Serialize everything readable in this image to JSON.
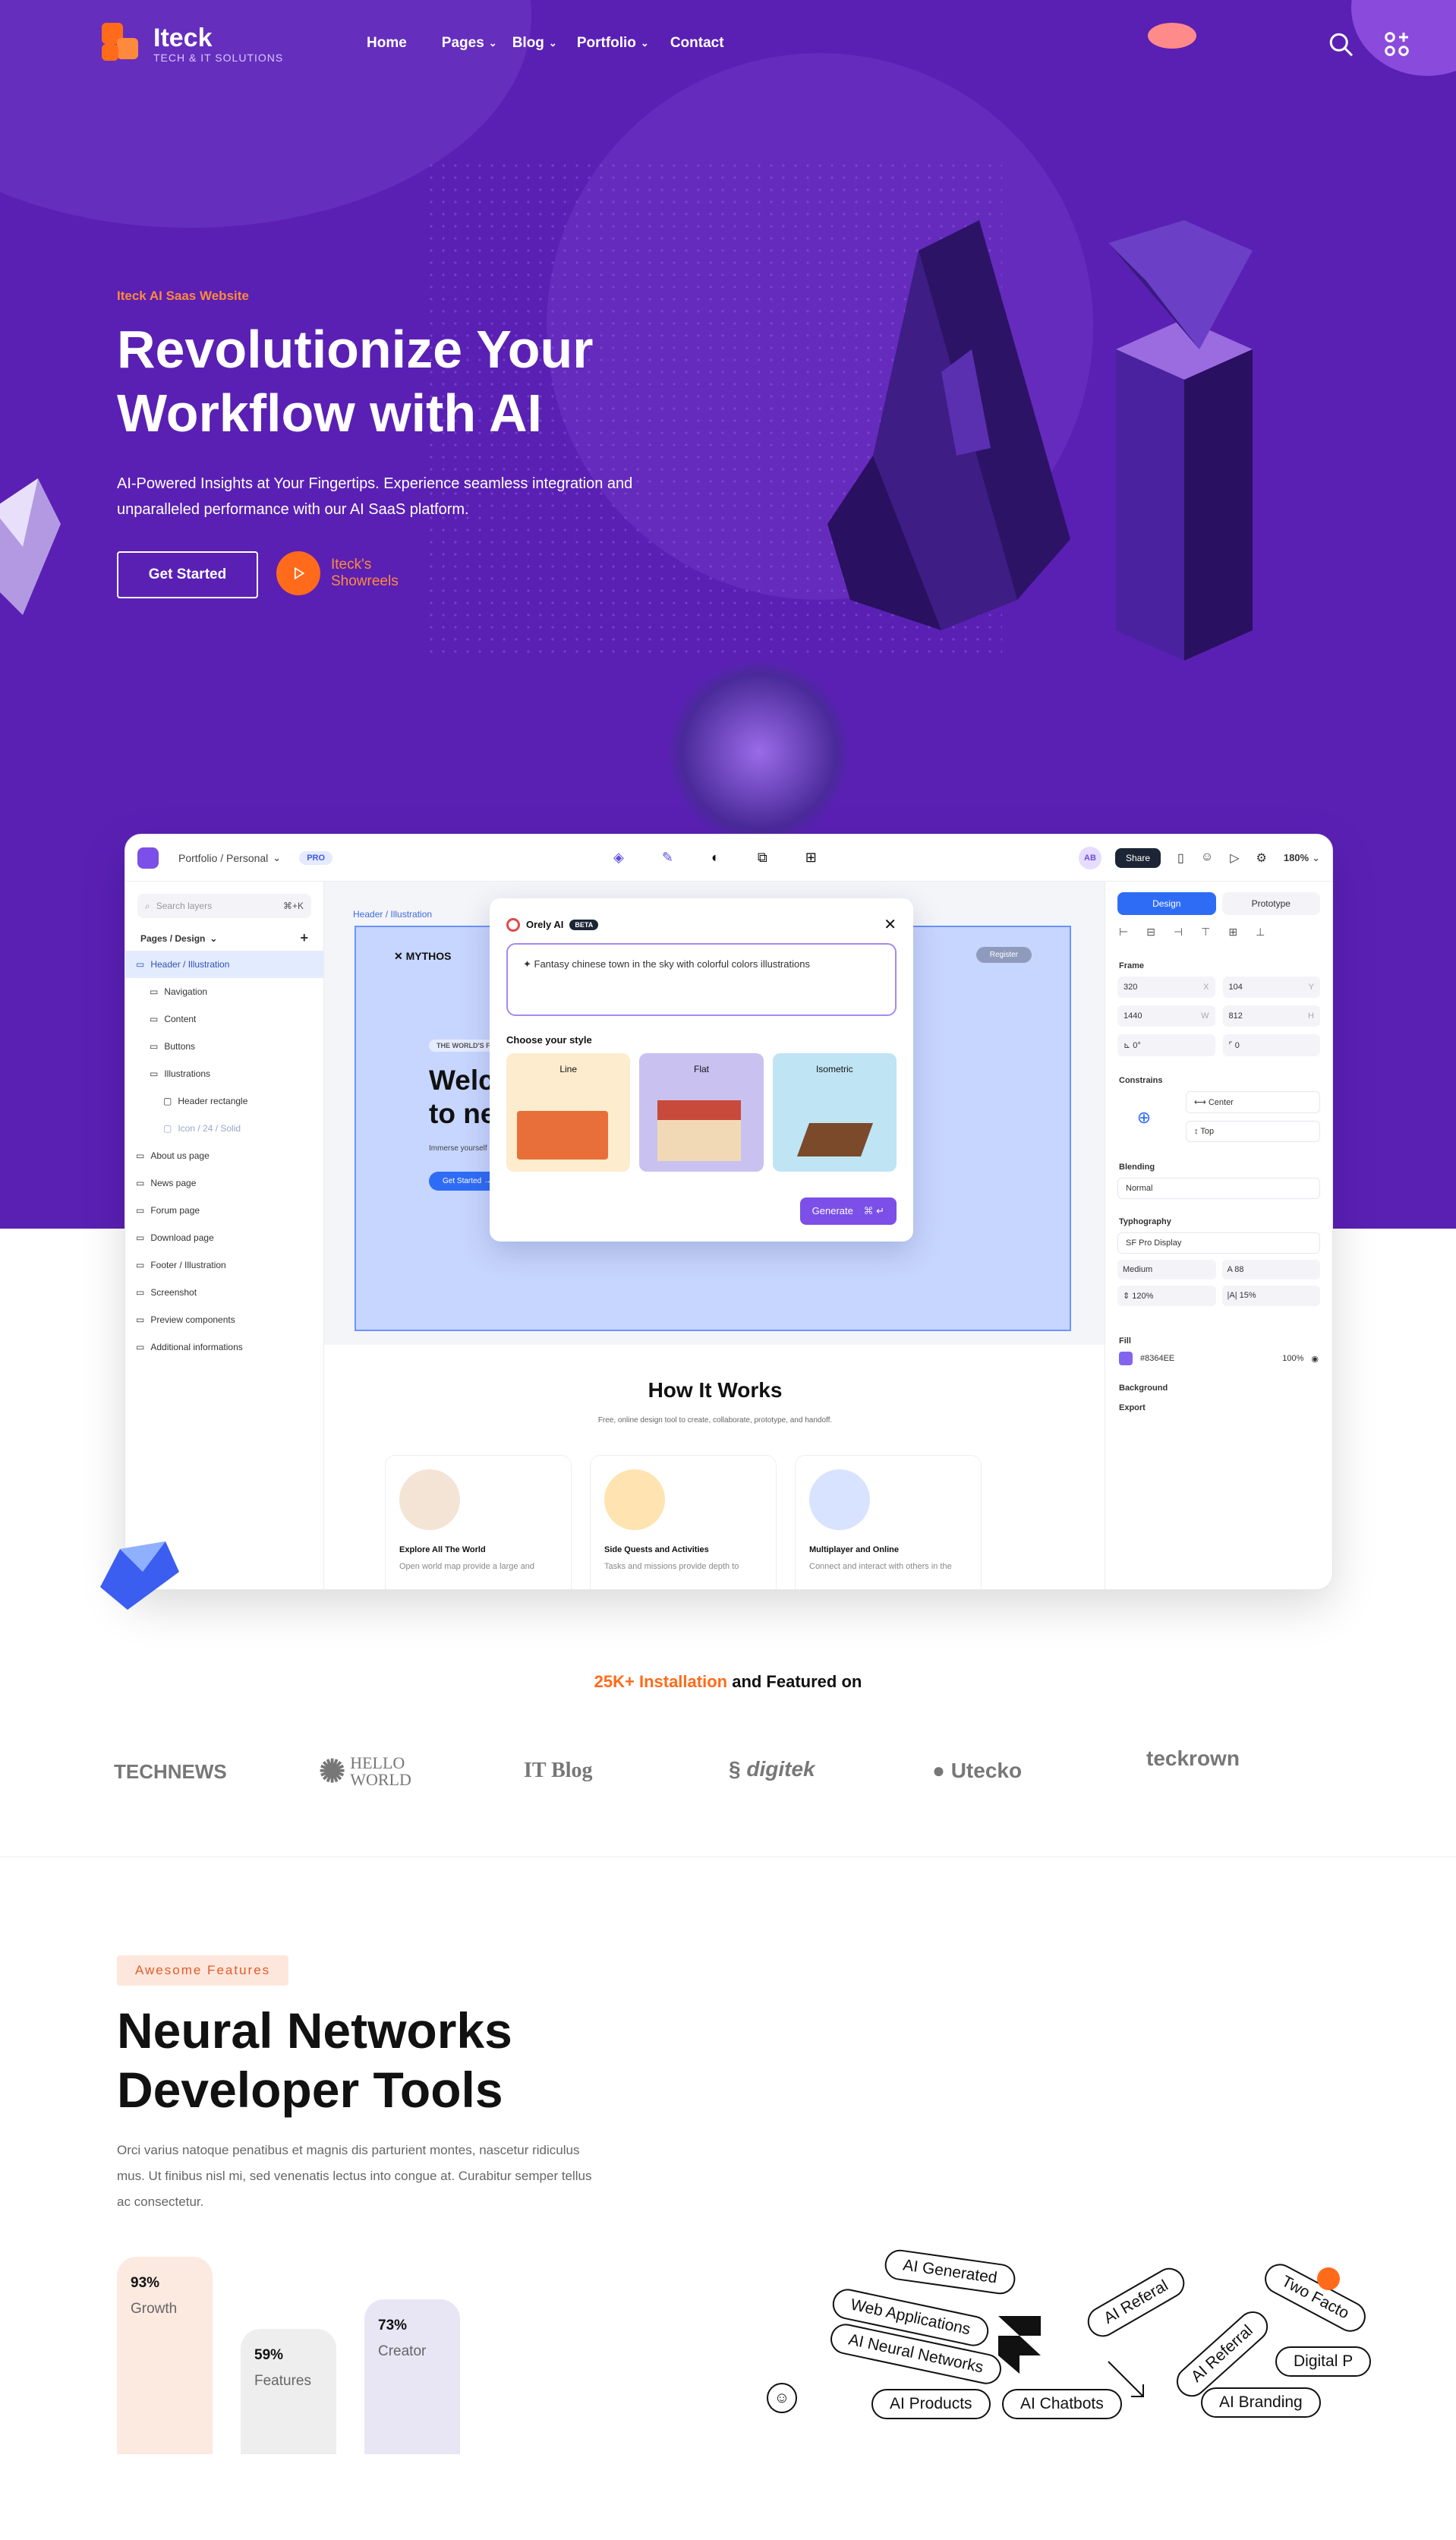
{
  "brand": {
    "name": "Iteck",
    "tagline": "TECH & IT SOLUTIONS"
  },
  "nav": [
    {
      "label": "Home",
      "dropdown": false
    },
    {
      "label": "Pages",
      "dropdown": true
    },
    {
      "label": "Blog",
      "dropdown": true
    },
    {
      "label": "Portfolio",
      "dropdown": true
    },
    {
      "label": "Contact",
      "dropdown": false
    }
  ],
  "hero": {
    "eyebrow": "Iteck AI Saas Website",
    "title": "Revolutionize Your Workflow with AI",
    "desc": "AI-Powered Insights at Your Fingertips. Experience seamless integration and unparalleled performance with our AI SaaS platform.",
    "cta": "Get Started",
    "reel": "Iteck's Showreels"
  },
  "app": {
    "breadcrumb": "Portfolio / Personal",
    "badge": "PRO",
    "share": "Share",
    "zoom": "180%",
    "avatar": "AB",
    "search_placeholder": "Search layers",
    "search_shortcut": "⌘+K",
    "pages_label": "Pages / Design",
    "layers": [
      "Header / Illustration",
      "Navigation",
      "Content",
      "Buttons",
      "Illustrations",
      "Header rectangle",
      "Icon / 24 / Solid",
      "About us page",
      "News page",
      "Forum page",
      "Download page",
      "Footer / Illustration",
      "Screenshot",
      "Preview components",
      "Additional informations"
    ],
    "frame_label": "Header / Illustration",
    "mythos": "MYTHOS",
    "register": "Register",
    "mock_badge": "THE WORLD'S FASTEST",
    "mock_title": "Welcome to new w",
    "mock_sub": "Immerse yourself in a wo",
    "mock_btn": "Get Started",
    "modal": {
      "title": "Orely AI",
      "beta": "BETA",
      "prompt": "Fantasy chinese town in the sky with colorful colors illustrations",
      "choose": "Choose your style",
      "styles": [
        "Line",
        "Flat",
        "Isometric"
      ],
      "generate": "Generate",
      "shortcut": "⌘"
    },
    "how": {
      "title": "How It Works",
      "sub": "Free, online design tool to create, collaborate, prototype, and handoff.",
      "cards": [
        {
          "title": "Explore All The World",
          "text": "Open world map provide a large and"
        },
        {
          "title": "Side Quests and Activities",
          "text": "Tasks and missions provide depth to"
        },
        {
          "title": "Multiplayer and Online",
          "text": "Connect and interact with others in the"
        }
      ]
    },
    "panel": {
      "tabs": [
        "Design",
        "Prototype"
      ],
      "frame": "Frame",
      "x": "320",
      "y": "104",
      "w": "1440",
      "h": "812",
      "rot": "0°",
      "radius": "0",
      "x_lbl": "X",
      "y_lbl": "Y",
      "w_lbl": "W",
      "h_lbl": "H",
      "constrains": "Constrains",
      "center": "Center",
      "top": "Top",
      "blending": "Blending",
      "normal": "Normal",
      "typography": "Typhography",
      "font": "SF Pro Display",
      "weight": "Medium",
      "size": "88",
      "lh": "120%",
      "ls": "15%",
      "fill": "Fill",
      "hex": "#8364EE",
      "opacity": "100%",
      "background": "Background",
      "export": "Export"
    }
  },
  "featured": {
    "highlight": "25K+ Installation",
    "rest": " and Featured on"
  },
  "logos": [
    "TECHNEWS",
    "HELLO WORLD",
    "IT Blog",
    "digitek",
    "Utecko",
    "teckrown"
  ],
  "features": {
    "badge": "Awesome Features",
    "title": "Neural Networks Developer Tools",
    "desc": "Orci varius natoque penatibus et magnis dis parturient montes, nascetur ridiculus mus. Ut finibus nisl mi, sed venenatis lectus into congue at. Curabitur semper tellus ac consectetur.",
    "bars": [
      {
        "value": "93%",
        "label": "Growth",
        "level": 0.93,
        "color": "#fce9e0"
      },
      {
        "value": "59%",
        "label": "Features",
        "level": 0.59,
        "color": "#eeeeee"
      },
      {
        "value": "73%",
        "label": "Creator",
        "level": 0.73,
        "color": "#e8e6f5"
      }
    ],
    "chips": [
      "AI Generated",
      "Web Applications",
      "AI Neural Networks",
      "AI Referal",
      "AI Referral",
      "Two Facto",
      "Digital P",
      "AI Products",
      "AI Chatbots",
      "AI Branding"
    ]
  },
  "colors": {
    "hero": "#5a20b4",
    "accent": "#ff6b1a",
    "primary": "#2f6cf6",
    "modal": "#7b4fe8"
  }
}
